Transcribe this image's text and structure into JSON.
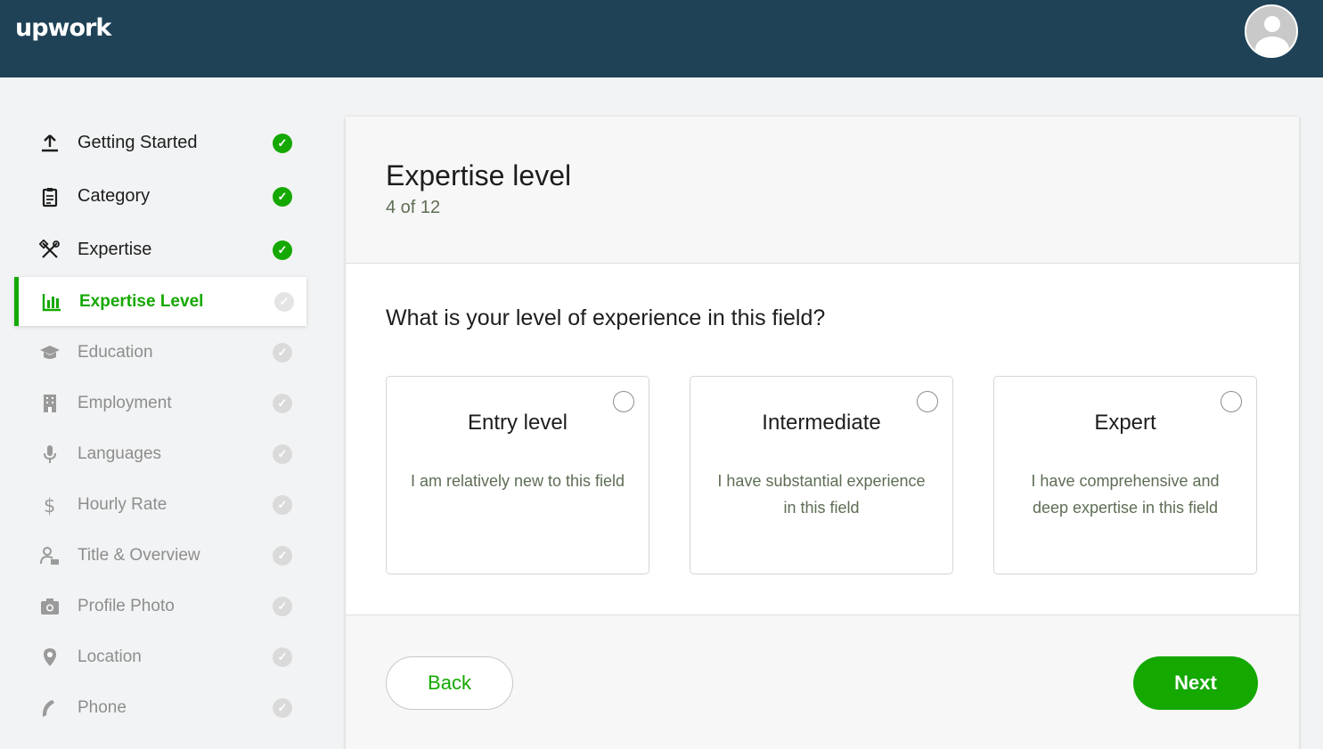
{
  "header": {
    "logo": "upwork",
    "avatar_icon": "user-avatar-icon"
  },
  "sidebar": {
    "items": [
      {
        "label": "Getting Started",
        "icon": "upload-icon",
        "status": "done"
      },
      {
        "label": "Category",
        "icon": "clipboard-icon",
        "status": "done"
      },
      {
        "label": "Expertise",
        "icon": "tools-icon",
        "status": "done"
      },
      {
        "label": "Expertise Level",
        "icon": "bar-chart-icon",
        "status": "active"
      },
      {
        "label": "Education",
        "icon": "graduation-cap-icon",
        "status": "pending"
      },
      {
        "label": "Employment",
        "icon": "building-icon",
        "status": "pending"
      },
      {
        "label": "Languages",
        "icon": "microphone-icon",
        "status": "pending"
      },
      {
        "label": "Hourly Rate",
        "icon": "dollar-icon",
        "status": "pending"
      },
      {
        "label": "Title & Overview",
        "icon": "user-edit-icon",
        "status": "pending"
      },
      {
        "label": "Profile Photo",
        "icon": "camera-icon",
        "status": "pending"
      },
      {
        "label": "Location",
        "icon": "map-pin-icon",
        "status": "pending"
      },
      {
        "label": "Phone",
        "icon": "phone-icon",
        "status": "pending"
      }
    ],
    "check_glyph": "✓"
  },
  "main": {
    "title": "Expertise level",
    "step_counter": "4 of 12",
    "question": "What is your level of experience in this field?",
    "options": [
      {
        "title": "Entry level",
        "description": "I am relatively new to this field"
      },
      {
        "title": "Intermediate",
        "description": "I have substantial experience in this field"
      },
      {
        "title": "Expert",
        "description": "I have comprehensive and deep expertise in this field"
      }
    ],
    "back_label": "Back",
    "next_label": "Next"
  },
  "colors": {
    "header_bg": "#1f4257",
    "accent_green": "#14a800",
    "muted_text": "#8d8d8d"
  }
}
